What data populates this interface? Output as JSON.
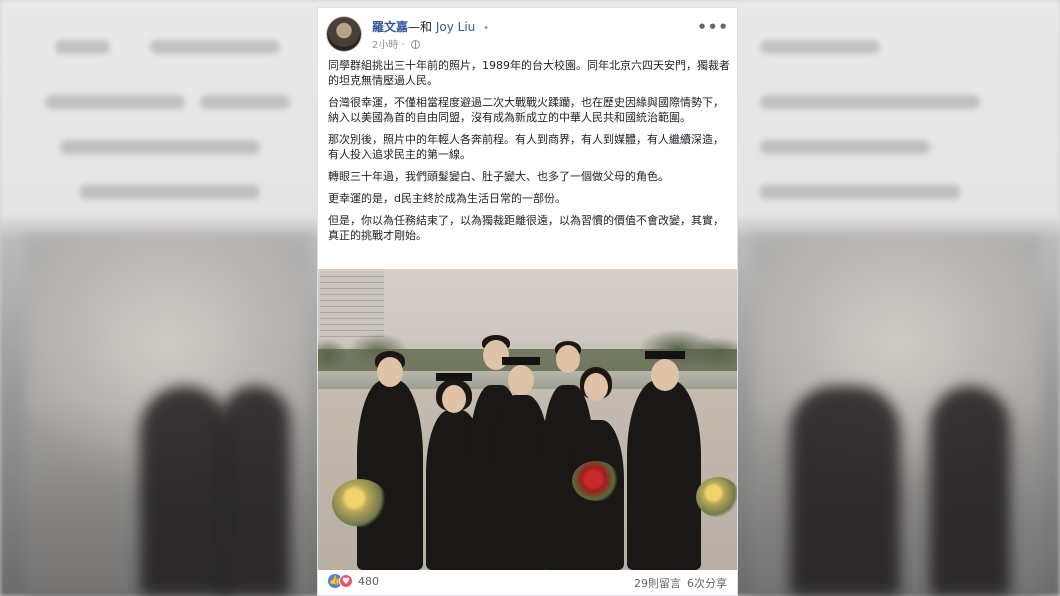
{
  "post": {
    "author": "羅文嘉",
    "with_separator": "—和",
    "tagged_user": "Joy Liu",
    "tag_dot": "•",
    "timestamp": "2小時",
    "meta_dot": "·",
    "privacy_icon": "globe-icon",
    "more_icon": "•••",
    "paragraphs": [
      "同學群組挑出三十年前的照片，1989年的台大校園。同年北京六四天安門，獨裁者的坦克無情壓過人民。",
      "台灣很幸運，不僅相當程度避過二次大戰戰火蹂躪，也在歷史因緣與國際情勢下，納入以美國為首的自由同盟，沒有成為新成立的中華人民共和國統治範圍。",
      "那次別後，照片中的年輕人各奔前程。有人到商界，有人到媒體，有人繼續深造，有人投入追求民主的第一線。",
      "轉眼三十年過，我們頭髮變白、肚子變大、也多了一個做父母的角色。",
      "更幸運的是，d民主終於成為生活日常的一部份。",
      "但是，你以為任務結束了，以為獨裁距離很遠，以為習慣的價值不會改變，其實，真正的挑戰才剛始。"
    ]
  },
  "reactions": {
    "like_icon": "thumbs-up-icon",
    "love_icon": "heart-icon",
    "count": "480"
  },
  "stats": {
    "comments": "29則留言",
    "shares": "6次分享"
  },
  "colors": {
    "link": "#365899",
    "meta": "#90949c",
    "like": "#4f80e1",
    "love": "#f25268"
  }
}
